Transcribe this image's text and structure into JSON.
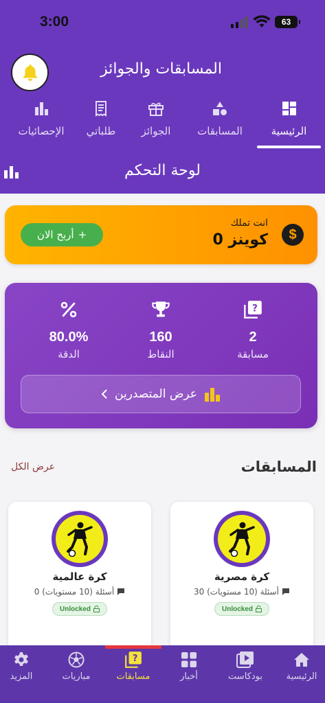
{
  "status_bar": {
    "time": "3:00",
    "battery": "63"
  },
  "header": {
    "title": "المسابقات والجوائز"
  },
  "tabs": [
    {
      "label": "الرئيسية",
      "icon": "grid-icon",
      "active": true
    },
    {
      "label": "المسابقات",
      "icon": "shapes-icon",
      "active": false
    },
    {
      "label": "الجوائز",
      "icon": "gift-icon",
      "active": false
    },
    {
      "label": "طلباتي",
      "icon": "receipt-icon",
      "active": false
    },
    {
      "label": "الإحصائيات",
      "icon": "bar-chart-icon",
      "active": false
    }
  ],
  "dashboard": {
    "title": "لوحة التحكم"
  },
  "coins": {
    "label": "انت تملك",
    "value": "0 كوينز",
    "earn_button": "أربح الان",
    "earn_plus": "+"
  },
  "stats": [
    {
      "value": "2",
      "label": "مسابقة",
      "icon": "quiz-icon"
    },
    {
      "value": "160",
      "label": "النقاط",
      "icon": "trophy-icon"
    },
    {
      "value": "80.0%",
      "label": "الدقة",
      "icon": "percent-icon"
    }
  ],
  "leaderboard_button": "عرض المتصدرين",
  "competitions": {
    "title": "المسابقات",
    "view_all": "عرض الكل",
    "items": [
      {
        "name": "كرة مصرية",
        "meta": "30 أسئلة (10 مستويات)",
        "status": "Unlocked"
      },
      {
        "name": "كرة عالمية",
        "meta": "0 أسئلة (10 مستويات)",
        "status": "Unlocked"
      }
    ]
  },
  "bottom_nav": [
    {
      "label": "الرئيسية",
      "icon": "home-icon",
      "active": false
    },
    {
      "label": "بودكاست",
      "icon": "video-icon",
      "active": false
    },
    {
      "label": "أخبار",
      "icon": "apps-icon",
      "active": false
    },
    {
      "label": "مسابقات",
      "icon": "quiz-icon",
      "active": true
    },
    {
      "label": "مباريات",
      "icon": "football-icon",
      "active": false
    },
    {
      "label": "المزيد",
      "icon": "gear-icon",
      "active": false
    }
  ],
  "colors": {
    "primary": "#6a38bd",
    "accent_orange": "#ff9c00",
    "success": "#47b04c",
    "active_nav": "#f4e13a",
    "nav_indicator": "#e5373f"
  }
}
